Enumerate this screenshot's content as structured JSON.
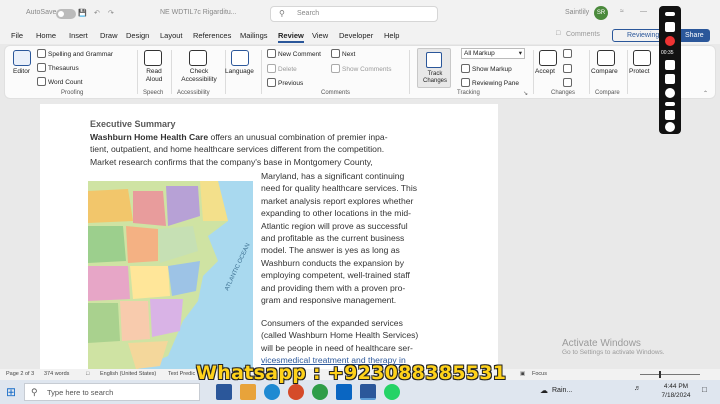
{
  "titlebar": {
    "autosave": "AutoSave",
    "toggle_state": "Off",
    "filename": "NE WDTIL7c Rigarditu...",
    "search_placeholder": "Search",
    "user": "Saintlily",
    "avatar_initials": "SR"
  },
  "menu": [
    "File",
    "Home",
    "Insert",
    "Draw",
    "Design",
    "Layout",
    "References",
    "Mailings",
    "Review",
    "View",
    "Developer",
    "Help"
  ],
  "menu_active": "Review",
  "menu_right": {
    "comments": "Comments",
    "reviewing": "Reviewing",
    "share": "Share"
  },
  "ribbon": {
    "proofing": {
      "editor": "Editor",
      "spelling": "Spelling and Grammar",
      "thesaurus": "Thesaurus",
      "word_count": "Word Count",
      "label": "Proofing"
    },
    "speech": {
      "read_aloud": "Read Aloud",
      "label": "Speech"
    },
    "accessibility": {
      "check": "Check Accessibility",
      "label": "Accessibility"
    },
    "language": {
      "btn": "Language"
    },
    "comments": {
      "new": "New Comment",
      "next": "Next",
      "delete": "Delete",
      "show": "Show Comments",
      "previous": "Previous",
      "label": "Comments"
    },
    "tracking": {
      "track": "Track Changes",
      "all_markup": "All Markup",
      "show_markup": "Show Markup",
      "reviewing_pane": "Reviewing Pane",
      "label": "Tracking"
    },
    "changes": {
      "accept": "Accept",
      "label": "Changes"
    },
    "compare": {
      "btn": "Compare",
      "label": "Compare"
    },
    "protect": {
      "btn": "Protect"
    }
  },
  "document": {
    "heading": "Executive Summary",
    "company_bold": "Washburn Home Health Care",
    "p1_rest": " offers an unusual combination of premier inpa-",
    "p1_lines": [
      "tient, outpatient, and home healthcare services different from the competition.",
      "Market research confirms that the company's base in Montgomery County,"
    ],
    "p2_lines": [
      "Maryland, has a significant continuing",
      "need for quality healthcare services. This",
      "market analysis report explores whether",
      "expanding to other locations in the mid-",
      "Atlantic region will prove as successful",
      "and profitable as the current business",
      "model. The answer is yes as long as",
      "Washburn conducts the expansion by",
      "employing competent, well-trained staff",
      "and providing them with a proven pro-",
      "gram and responsive management."
    ],
    "p3_lines": [
      "Consumers of the expanded services",
      "(called Washburn Home Health Services)",
      "will be people in need of healthcare ser-",
      "vicesmedical treatment and therapy in"
    ],
    "map_label": "ATLANTIC OCEAN"
  },
  "watermark": {
    "title": "Activate Windows",
    "sub": "Go to Settings to activate Windows."
  },
  "status": {
    "page": "Page 2 of 3",
    "words": "374 words",
    "language": "English (United States)",
    "predictions": "Text Predic",
    "focus": "Focus"
  },
  "overlay": {
    "whatsapp": "Whatsapp : +923088385531"
  },
  "taskbar": {
    "search": "Type here to search",
    "weather": "Rain...",
    "time": "4:44 PM",
    "date": "7/18/2024"
  },
  "floatbar": {
    "timer": "00:35"
  },
  "colors": {
    "accent": "#2b579a",
    "overlay_text": "#ffd21a"
  }
}
